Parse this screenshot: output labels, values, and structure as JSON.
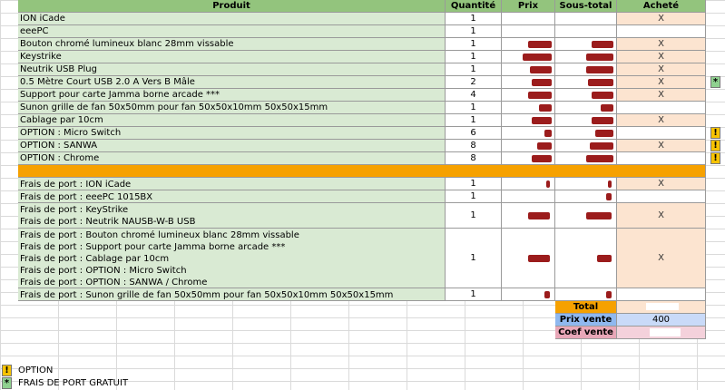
{
  "headers": {
    "product": "Produit",
    "qty": "Quantité",
    "price": "Prix",
    "subtotal": "Sous-total",
    "bought": "Acheté"
  },
  "rows": [
    {
      "product": "ION iCade",
      "qty": "1",
      "bought": "X",
      "link": false
    },
    {
      "product": "eeePC",
      "qty": "1",
      "bought": "",
      "link": false
    },
    {
      "product": "Bouton chromé lumineux blanc 28mm vissable",
      "qty": "1",
      "bought": "X",
      "link": true
    },
    {
      "product": "Keystrike",
      "qty": "1",
      "bought": "X",
      "link": true
    },
    {
      "product": "Neutrik USB Plug",
      "qty": "1",
      "bought": "X",
      "link": true
    },
    {
      "product": "0.5 Mètre Court USB 2.0 A Vers B Mâle",
      "qty": "2",
      "bought": "X",
      "link": true
    },
    {
      "product": "Support pour carte Jamma borne arcade ***",
      "qty": "4",
      "bought": "X",
      "link": true
    },
    {
      "product": "Sunon grille de fan 50x50mm pour fan 50x50x10mm 50x50x15mm",
      "qty": "1",
      "bought": "",
      "link": true
    },
    {
      "product": "Cablage par 10cm",
      "qty": "1",
      "bought": "X",
      "link": false
    },
    {
      "product": "OPTION : Micro Switch",
      "qty": "6",
      "bought": "",
      "link": true
    },
    {
      "product": "OPTION : SANWA",
      "qty": "8",
      "bought": "X",
      "link": true
    },
    {
      "product": "OPTION : Chrome",
      "qty": "8",
      "bought": "",
      "link": true
    }
  ],
  "shipping": [
    {
      "lines": [
        "Frais de port : ION iCade"
      ],
      "qty": "1",
      "bought": "X"
    },
    {
      "lines": [
        "Frais de port : eeePC 1015BX"
      ],
      "qty": "1",
      "bought": ""
    },
    {
      "lines": [
        "Frais de port : KeyStrike",
        "Frais de port : Neutrik NAUSB-W-B USB"
      ],
      "qty": "1",
      "bought": "X"
    },
    {
      "lines": [
        "Frais de port : Bouton chromé lumineux blanc 28mm vissable",
        "Frais de port : Support pour carte Jamma borne arcade ***",
        "Frais de port : Cablage par 10cm",
        "Frais de port : OPTION : Micro Switch",
        "Frais de port : OPTION : SANWA / Chrome"
      ],
      "qty": "1",
      "bought": "X"
    },
    {
      "lines": [
        "Frais de port : Sunon grille de fan 50x50mm pour fan 50x50x10mm 50x50x15mm"
      ],
      "qty": "1",
      "bought": ""
    }
  ],
  "summary": {
    "total_label": "Total",
    "prix_vente_label": "Prix vente",
    "prix_vente_value": "400",
    "coef_label": "Coef vente"
  },
  "markers": {
    "option_symbol": "!",
    "free_symbol": "*"
  },
  "legend": {
    "option": "OPTION",
    "free": "FRAIS DE PORT GRATUIT"
  },
  "colors": {
    "header": "#93c47d",
    "product_bg": "#d9ead3",
    "bought_bg": "#fce4d0",
    "separator": "#f6a100",
    "option_marker": "#f7c300",
    "free_marker": "#8fd18f",
    "link": "#3333cc",
    "redacted": "#9b1c1c"
  }
}
